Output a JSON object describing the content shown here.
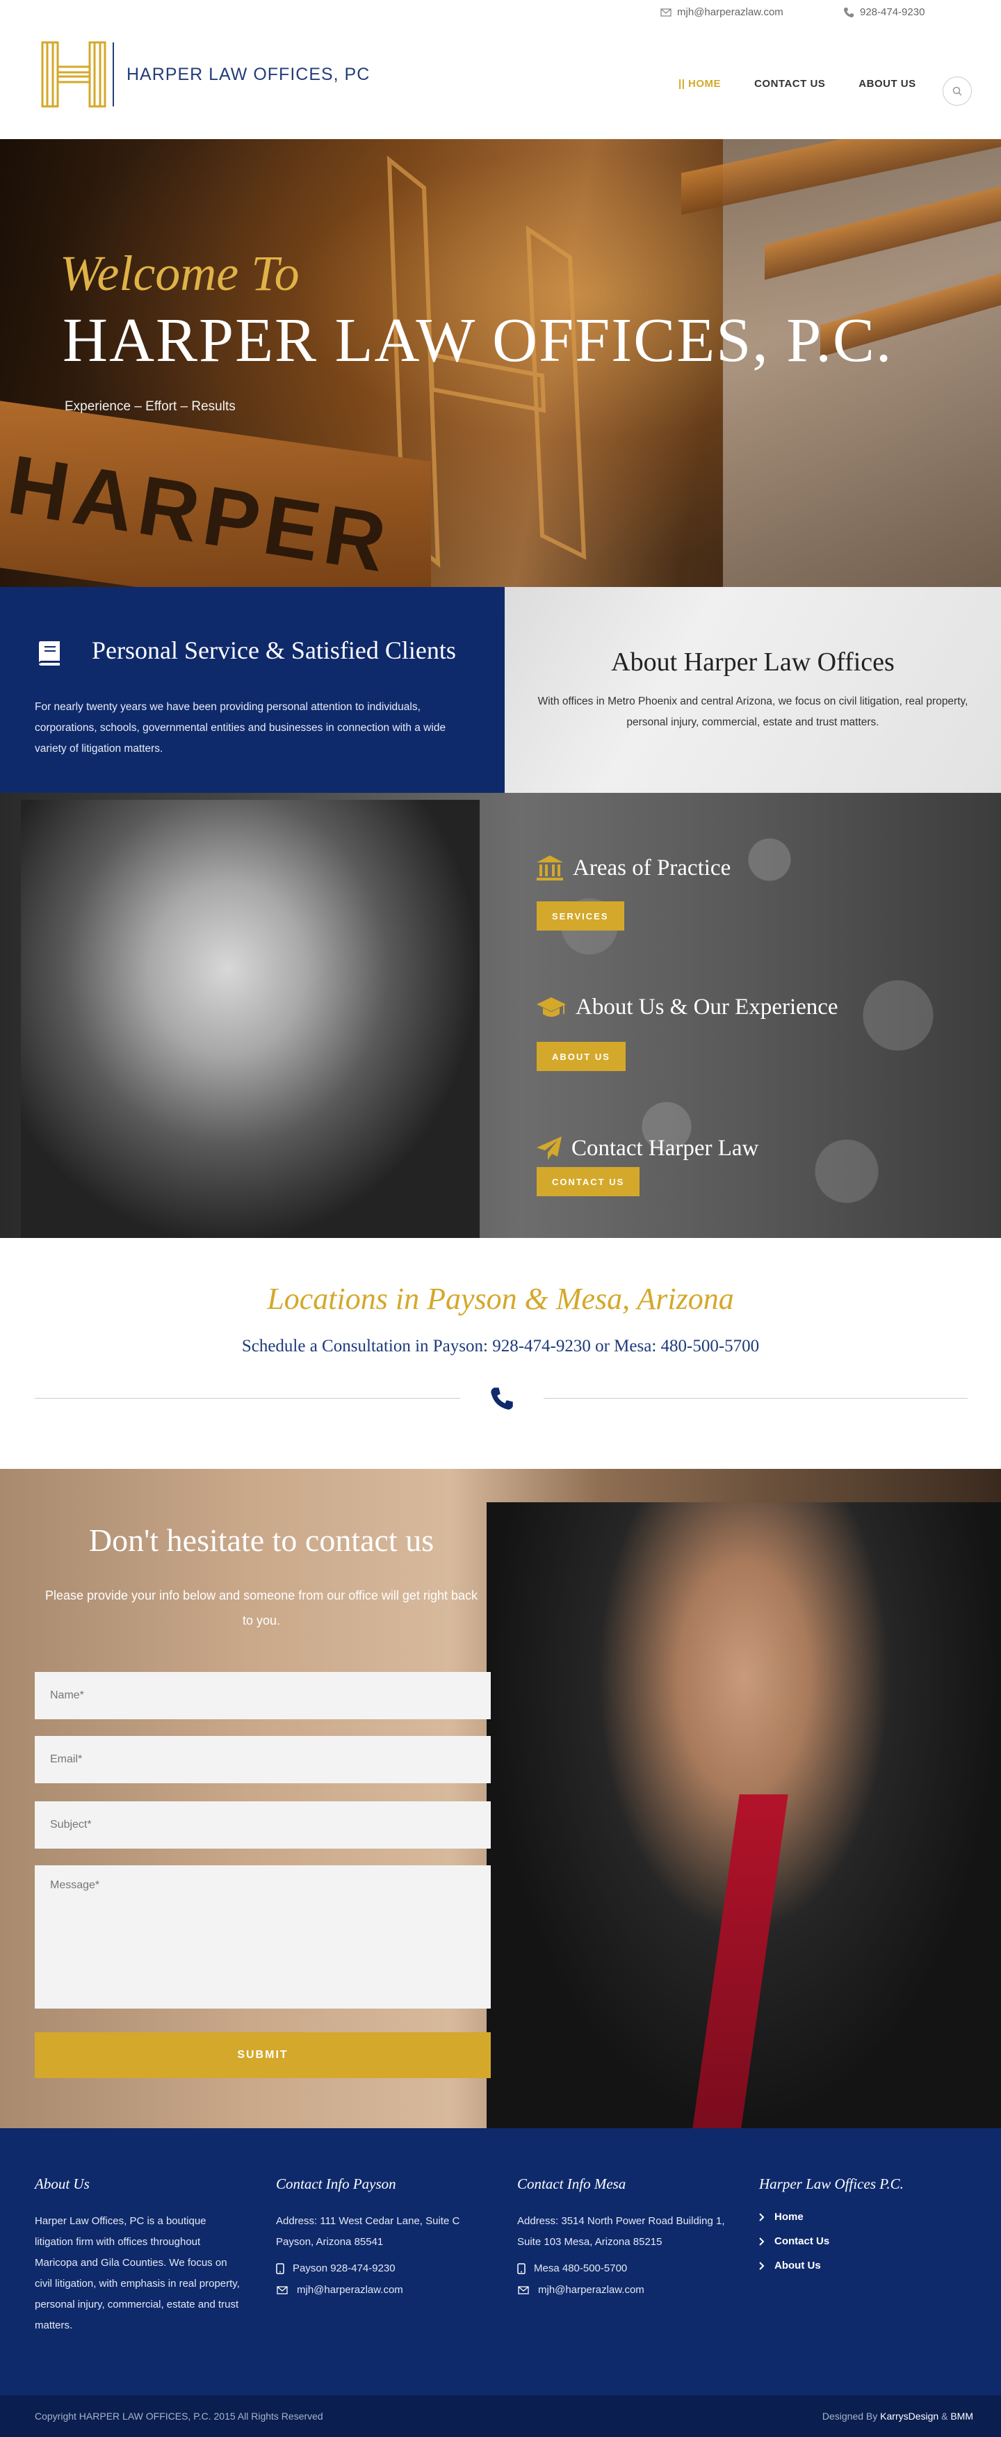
{
  "topbar": {
    "email": "mjh@harperazlaw.com",
    "phone": "928-474-9230"
  },
  "logo": {
    "text": "HARPER LAW OFFICES, PC"
  },
  "nav": {
    "items": [
      {
        "label": "|| HOME",
        "active": true
      },
      {
        "label": "CONTACT US",
        "active": false
      },
      {
        "label": "ABOUT US",
        "active": false
      }
    ]
  },
  "hero": {
    "welcome": "Welcome To",
    "title": "HARPER LAW OFFICES, P.C.",
    "tagline": "Experience – Effort – Results"
  },
  "intro": {
    "left_title": "Personal Service & Satisfied Clients",
    "left_text": "For nearly twenty years we have been providing personal attention to individuals, corporations, schools, governmental entities and businesses in connection with a wide variety of litigation matters.",
    "right_title": "About Harper Law Offices",
    "right_text": "With offices in Metro Phoenix and central Arizona, we focus on civil litigation, real property, personal injury, commercial, estate and trust matters."
  },
  "practice": {
    "items": [
      {
        "title": "Areas of Practice",
        "button": "SERVICES"
      },
      {
        "title": "About Us & Our Experience",
        "button": "ABOUT US"
      },
      {
        "title": "Contact Harper Law",
        "button": "CONTACT US"
      }
    ]
  },
  "locations": {
    "title": "Locations in Payson & Mesa, Arizona",
    "subtitle": "Schedule a Consultation in Payson: 928-474-9230 or Mesa: 480-500-5700"
  },
  "contact": {
    "title": "Don't hesitate to contact us",
    "text": "Please provide your info below and someone from our office will get right back to you.",
    "name_placeholder": "Name*",
    "email_placeholder": "Email*",
    "subject_placeholder": "Subject*",
    "message_placeholder": "Message*",
    "submit": "SUBMIT"
  },
  "footer": {
    "about_title": "About Us",
    "about_text": "Harper Law Offices, PC is a boutique litigation firm with offices throughout Maricopa and Gila Counties. We focus on civil litigation, with emphasis in real property, personal injury, commercial, estate and trust matters.",
    "payson_title": "Contact Info Payson",
    "payson_address": "Address: 111 West Cedar Lane, Suite C Payson, Arizona 85541",
    "payson_phone": "Payson 928-474-9230",
    "payson_email": "mjh@harperazlaw.com",
    "mesa_title": "Contact Info Mesa",
    "mesa_address": "Address: 3514 North Power Road Building 1, Suite 103 Mesa, Arizona 85215",
    "mesa_phone": "Mesa 480-500-5700",
    "mesa_email": "mjh@harperazlaw.com",
    "links_title": "Harper Law Offices P.C.",
    "links": [
      "Home",
      "Contact Us",
      "About Us"
    ],
    "copyright": "Copyright HARPER LAW OFFICES, P.C. 2015 All Rights Reserved",
    "designed_prefix": "Designed By",
    "designer": "KarrysDesign",
    "designer_amp": "&",
    "designer2": "BMM"
  },
  "colors": {
    "navy": "#0f2a6b",
    "gold": "#d4a82a"
  },
  "icons": [
    "envelope-icon",
    "phone-icon",
    "search-icon",
    "book-icon",
    "bank-icon",
    "graduation-cap-icon",
    "paper-plane-icon",
    "chevron-right-icon"
  ]
}
